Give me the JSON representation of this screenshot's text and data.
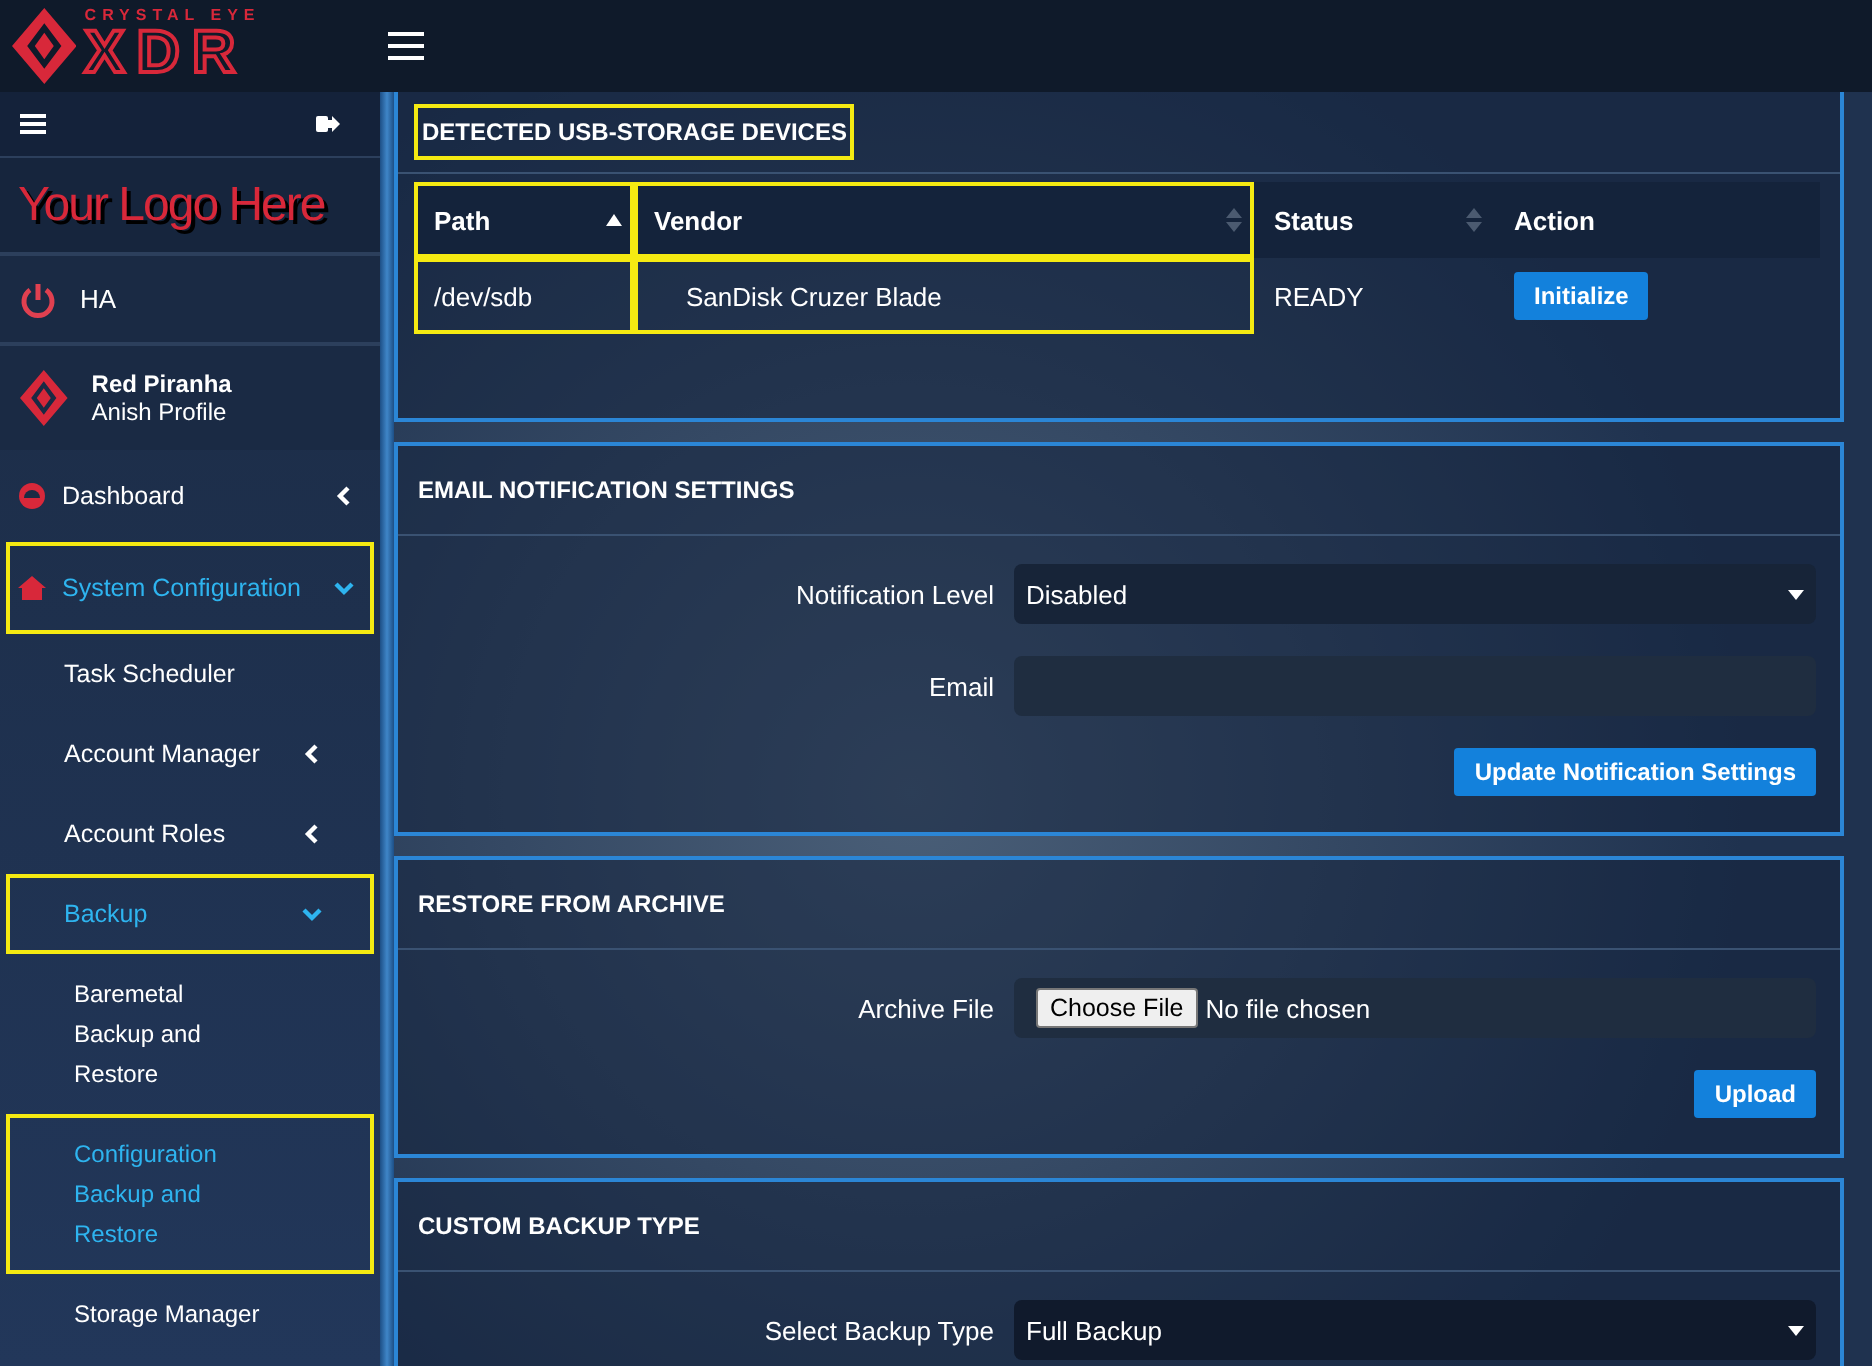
{
  "brand": {
    "tagline": "CRYSTAL EYE",
    "name": "XDR"
  },
  "sidebar": {
    "custom_logo": "Your Logo Here",
    "ha": {
      "label": "HA"
    },
    "profile": {
      "name": "Red Piranha",
      "profile": "Anish Profile"
    },
    "menu": [
      {
        "label": "Dashboard",
        "expanded": false,
        "selected": false,
        "highlighted": false
      },
      {
        "label": "System Configuration",
        "expanded": true,
        "selected": true,
        "highlighted": true,
        "children": [
          {
            "label": "Task Scheduler",
            "selected": false,
            "highlighted": false
          },
          {
            "label": "Account Manager",
            "expanded": false,
            "selected": false,
            "highlighted": false
          },
          {
            "label": "Account Roles",
            "expanded": false,
            "selected": false,
            "highlighted": false
          },
          {
            "label": "Backup",
            "expanded": true,
            "selected": true,
            "highlighted": true,
            "children": [
              {
                "label": "Baremetal Backup and Restore",
                "selected": false,
                "highlighted": false
              },
              {
                "label": "Configuration Backup and Restore",
                "selected": true,
                "highlighted": true
              },
              {
                "label": "Storage Manager",
                "selected": false,
                "highlighted": false
              }
            ]
          }
        ]
      }
    ]
  },
  "usb_panel": {
    "title": "DETECTED USB-STORAGE DEVICES",
    "highlighted": true,
    "columns": [
      {
        "label": "Path",
        "sorted": true,
        "highlighted": true
      },
      {
        "label": "Vendor",
        "sorted": false,
        "highlighted": true
      },
      {
        "label": "Status",
        "sorted": false,
        "highlighted": false
      },
      {
        "label": "Action",
        "highlighted": false
      }
    ],
    "rows": [
      {
        "path": "/dev/sdb",
        "vendor": "SanDisk Cruzer Blade",
        "status": "READY",
        "action": "Initialize"
      }
    ]
  },
  "email_panel": {
    "title": "EMAIL NOTIFICATION SETTINGS",
    "level_label": "Notification Level",
    "level_value": "Disabled",
    "email_label": "Email",
    "button": "Update Notification Settings"
  },
  "restore_panel": {
    "title": "RESTORE FROM ARCHIVE",
    "file_label": "Archive File",
    "choose": "Choose File",
    "file_status": "No file chosen",
    "button": "Upload"
  },
  "backup_type_panel": {
    "title": "CUSTOM BACKUP TYPE",
    "label": "Select Backup Type",
    "value": "Full Backup"
  }
}
